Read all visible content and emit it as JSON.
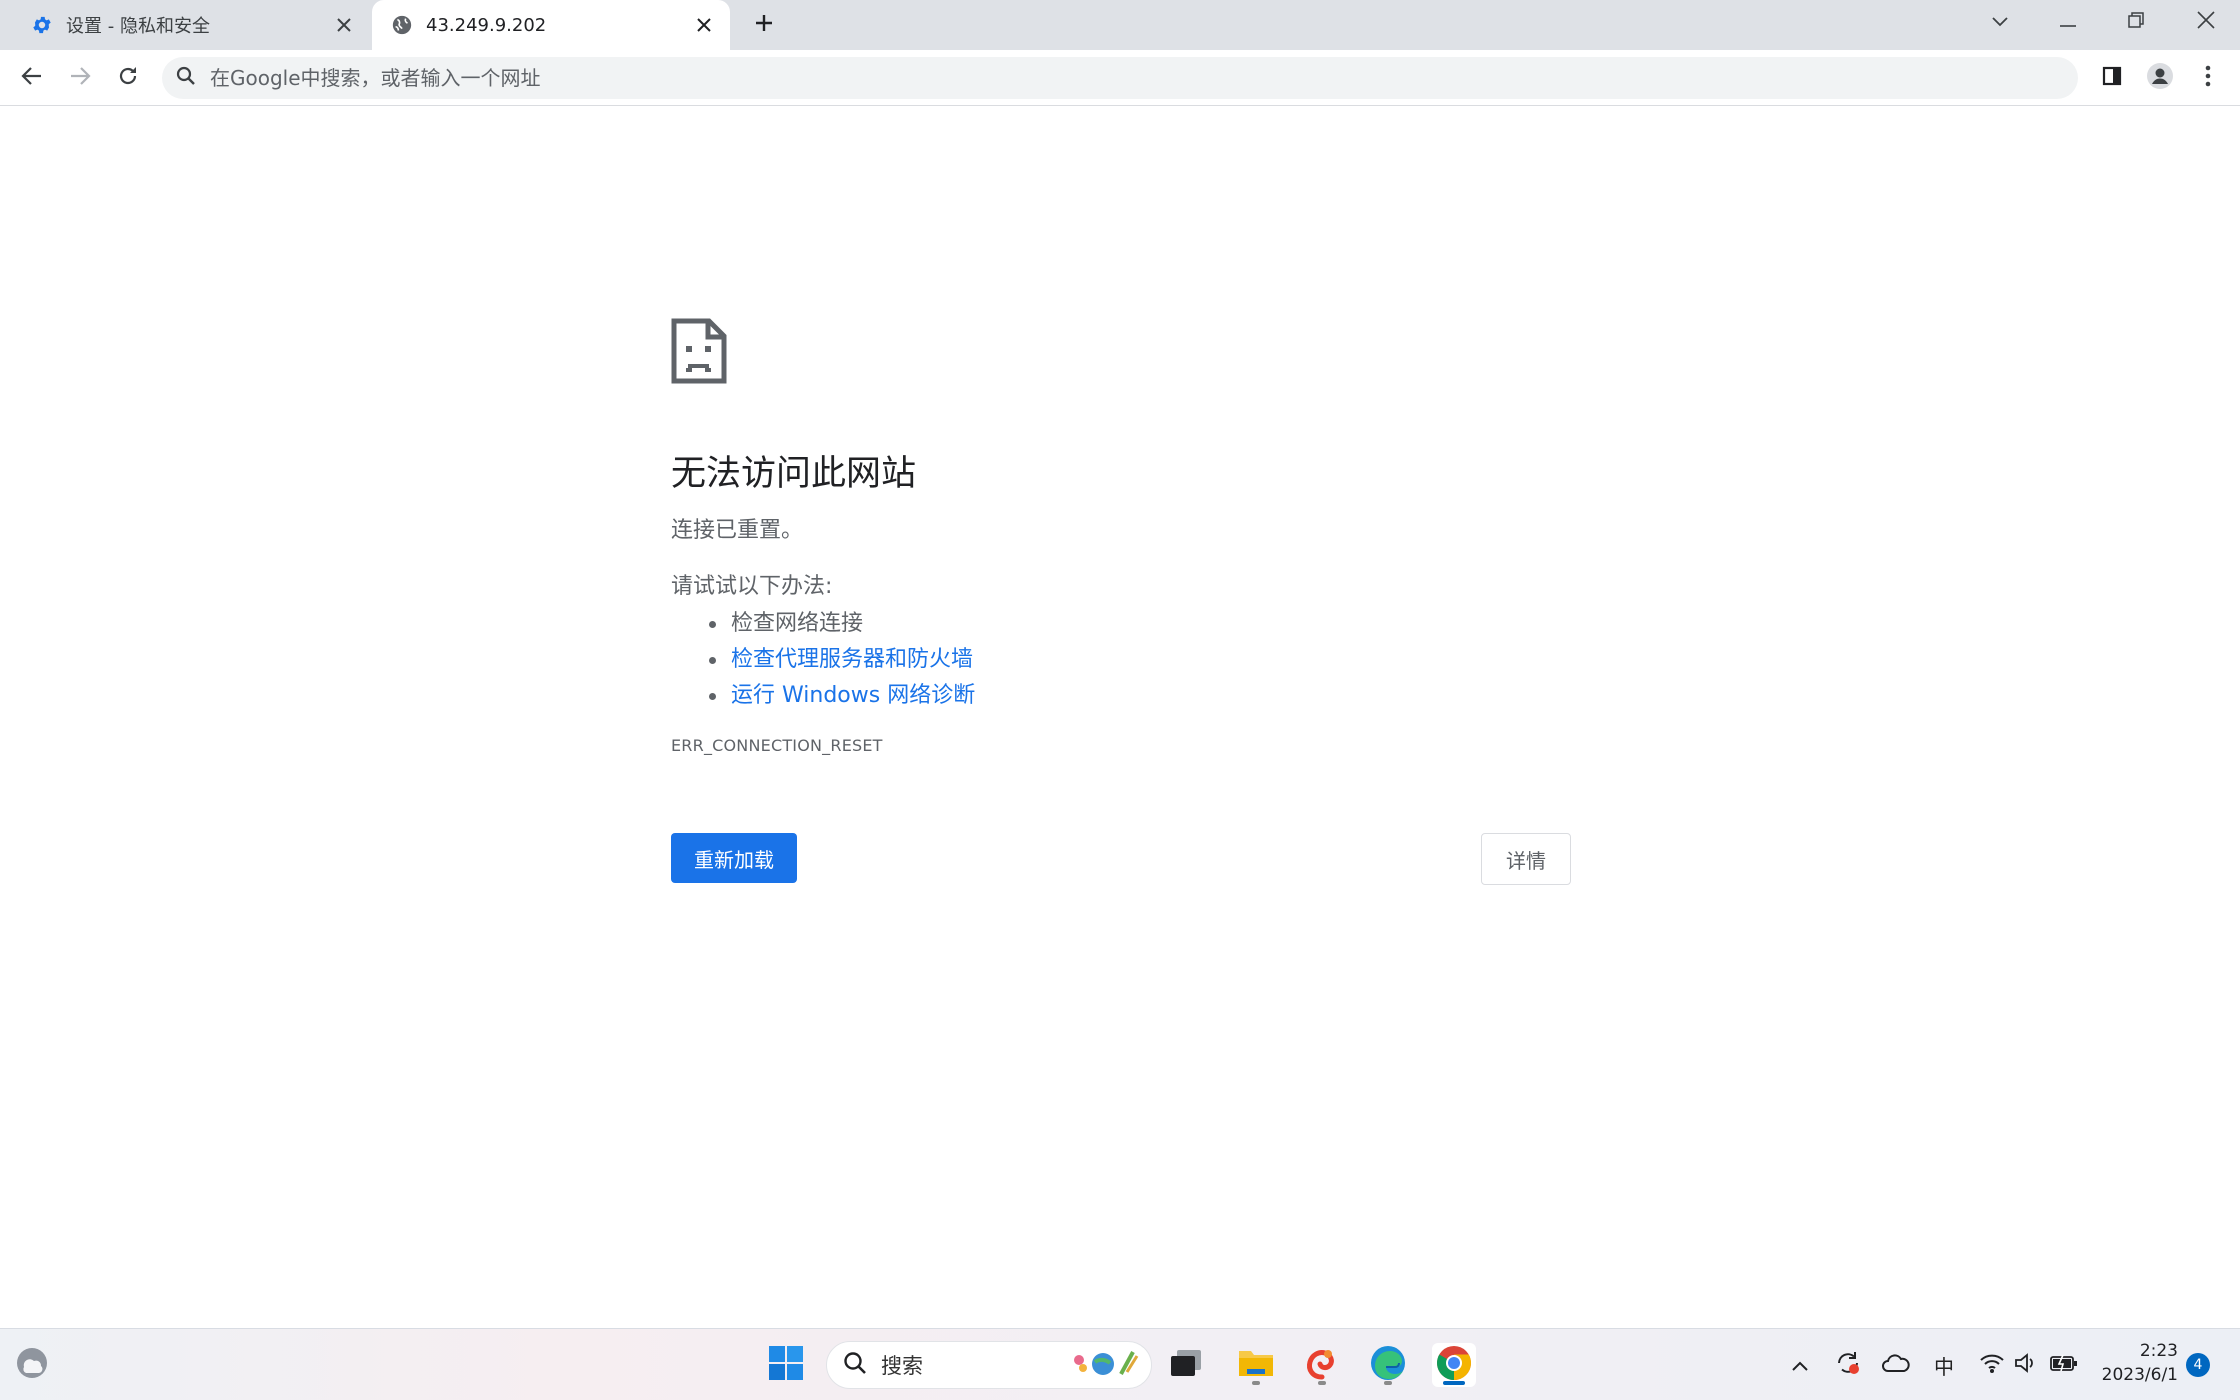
{
  "browser": {
    "tabs": [
      {
        "title": "设置 - 隐私和安全",
        "icon": "gear-icon",
        "active": false
      },
      {
        "title": "43.249.9.202",
        "icon": "globe-icon",
        "active": true
      }
    ],
    "omnibox": {
      "placeholder": "在Google中搜索，或者输入一个网址",
      "value": ""
    }
  },
  "error_page": {
    "title": "无法访问此网站",
    "description": "连接已重置。",
    "try_label": "请试试以下办法:",
    "suggestions": [
      {
        "text": "检查网络连接",
        "link": false
      },
      {
        "text": "检查代理服务器和防火墙",
        "link": true
      },
      {
        "text": "运行 Windows 网络诊断",
        "link": true
      }
    ],
    "error_code": "ERR_CONNECTION_RESET",
    "reload_label": "重新加载",
    "details_label": "详情"
  },
  "colors": {
    "accent": "#1a73e8",
    "tab_strip": "#dee1e6",
    "text_secondary": "#5f6368"
  },
  "taskbar": {
    "search_label": "搜索",
    "ime_label": "中",
    "time": "2:23",
    "date": "2023/6/1",
    "notification_count": "4"
  }
}
